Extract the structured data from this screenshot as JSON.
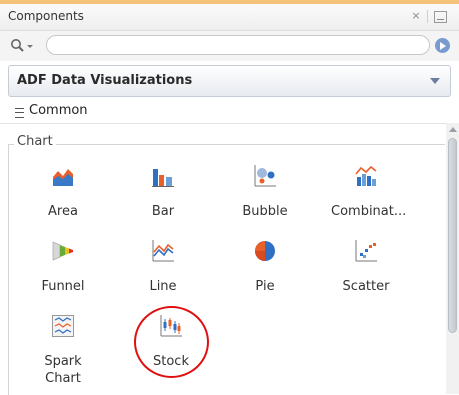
{
  "panel": {
    "title": "Components",
    "close_glyph": "×",
    "accent": "#f5c27a"
  },
  "search": {
    "value": "",
    "placeholder": ""
  },
  "library": {
    "selected": "ADF Data Visualizations"
  },
  "section": {
    "label": "Common"
  },
  "category": {
    "label": "Chart"
  },
  "items": [
    {
      "label": "Area",
      "icon": "area-chart-icon"
    },
    {
      "label": "Bar",
      "icon": "bar-chart-icon"
    },
    {
      "label": "Bubble",
      "icon": "bubble-chart-icon"
    },
    {
      "label": "Combinat...",
      "icon": "combination-chart-icon"
    },
    {
      "label": "Funnel",
      "icon": "funnel-chart-icon"
    },
    {
      "label": "Line",
      "icon": "line-chart-icon"
    },
    {
      "label": "Pie",
      "icon": "pie-chart-icon"
    },
    {
      "label": "Scatter",
      "icon": "scatter-chart-icon"
    },
    {
      "label": "Spark Chart",
      "icon": "spark-chart-icon"
    },
    {
      "label": "Stock",
      "icon": "stock-chart-icon"
    }
  ],
  "annotation": {
    "ring_color": "#e01010",
    "target": "Stock"
  }
}
